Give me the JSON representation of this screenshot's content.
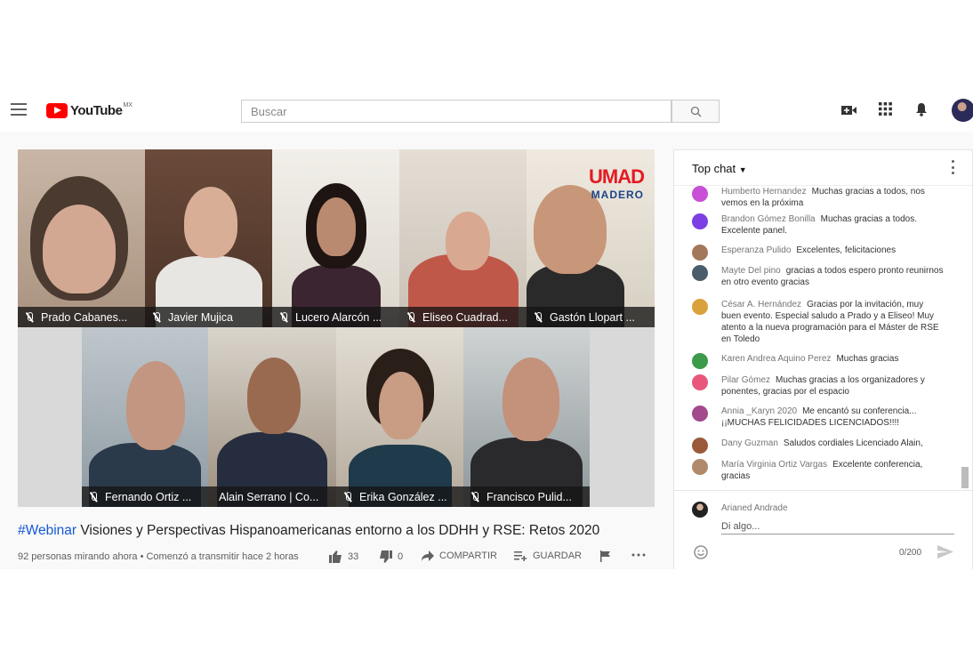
{
  "masthead": {
    "logo_text": "YouTube",
    "logo_region": "MX",
    "search_placeholder": "Buscar"
  },
  "video": {
    "participants": [
      {
        "name": "Prado Cabanes..."
      },
      {
        "name": "Javier Mujica"
      },
      {
        "name": "Lucero Alarcón ..."
      },
      {
        "name": "Eliseo Cuadrad..."
      },
      {
        "name": "Gastón Llopart ..."
      },
      {
        "name": "Fernando Ortiz ..."
      },
      {
        "name": "Alain Serrano | Co..."
      },
      {
        "name": "Erika González ..."
      },
      {
        "name": "Francisco Pulid..."
      }
    ],
    "brand_line1": "UMAD",
    "brand_line2": "MADERO",
    "title_hashtag": "#Webinar",
    "title_rest": " Visiones y Perspectivas Hispanoamericanas entorno a los DDHH y RSE: Retos 2020",
    "views": "92 personas mirando ahora • Comenzó a transmitir hace 2 horas",
    "likes": "33",
    "dislikes": "0",
    "share_label": "COMPARTIR",
    "save_label": "GUARDAR"
  },
  "chat": {
    "header": "Top chat",
    "messages": [
      {
        "author": "Humberto Hernandez",
        "text": "Muchas gracias a todos, nos vemos en la próxima",
        "color": "#c84fd6"
      },
      {
        "author": "Brandon Gómez Bonilla",
        "text": "Muchas gracias a todos. Excelente panel.",
        "color": "#7b3fe4"
      },
      {
        "author": "Esperanza Pulido",
        "text": "Excelentes, felicitaciones",
        "color": "#a3785a"
      },
      {
        "author": "Mayte Del pino",
        "text": "gracias a todos espero pronto reunirnos en otro evento gracias",
        "color": "#4b5d6b"
      },
      {
        "author": "César A. Hernández",
        "text": "Gracias por la invitación, muy buen evento. Especial saludo a Prado y a Eliseo! Muy atento a la nueva programación para el Máster de RSE en Toledo",
        "color": "#d9a23c"
      },
      {
        "author": "Karen Andrea Aquino Perez",
        "text": "Muchas gracias",
        "color": "#3c9a4a"
      },
      {
        "author": "Pilar Gómez",
        "text": "Muchas gracias a los organizadores y ponentes, gracias por el espacio",
        "color": "#e8567c"
      },
      {
        "author": "Annia _Karyn 2020",
        "text": "Me encantó su conferencia... ¡¡MUCHAS FELICIDADES LICENCIADOS!!!!",
        "color": "#a24a8c"
      },
      {
        "author": "Dany Guzman",
        "text": "Saludos cordiales Licenciado Alain,",
        "color": "#9a5a3a"
      },
      {
        "author": "María Virginia Ortiz Vargas",
        "text": "Excelente conferencia, gracias",
        "color": "#b08a6a"
      }
    ],
    "input_author": "Arianed Andrade",
    "input_placeholder": "Di algo...",
    "char_count": "0/200"
  }
}
